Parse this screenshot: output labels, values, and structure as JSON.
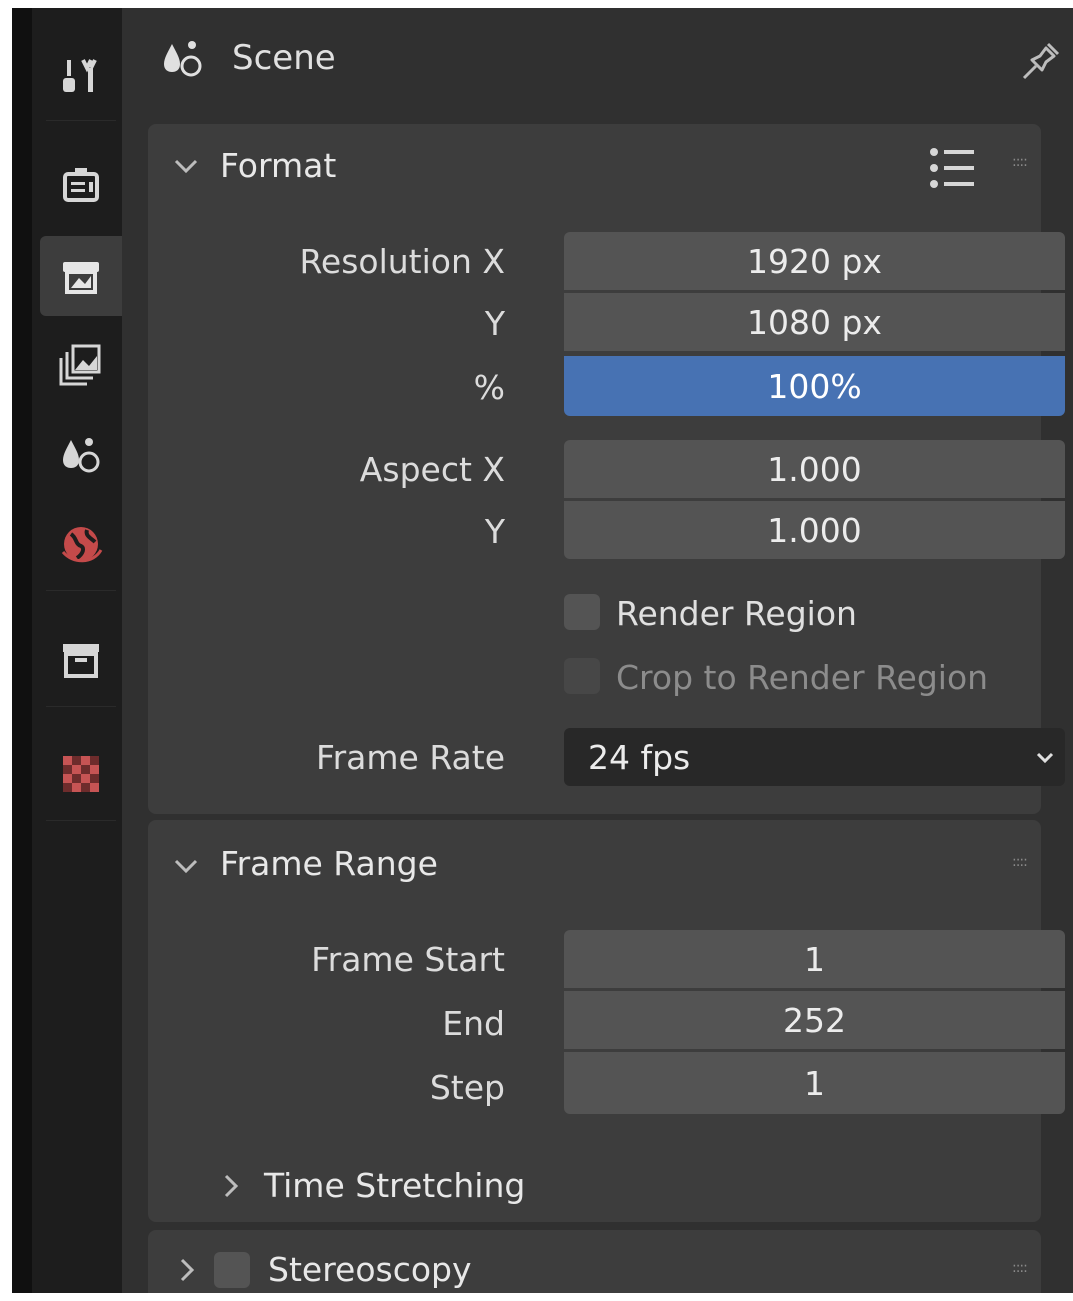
{
  "header": {
    "title": "Scene",
    "scene_icon": "scene-icon",
    "pin_icon": "pin-icon"
  },
  "sidebar": {
    "tabs": [
      {
        "name": "tool-tab",
        "icon": "tool-icon",
        "active": false
      },
      {
        "name": "render-tab",
        "icon": "render-icon",
        "active": false
      },
      {
        "name": "output-tab",
        "icon": "output-printer-icon",
        "active": true
      },
      {
        "name": "view-layer-tab",
        "icon": "view-layer-icon",
        "active": false
      },
      {
        "name": "scene-tab",
        "icon": "scene-icon",
        "active": false
      },
      {
        "name": "world-tab",
        "icon": "world-icon",
        "active": false
      },
      {
        "name": "collection-tab",
        "icon": "collection-box-icon",
        "active": false
      },
      {
        "name": "texture-tab",
        "icon": "texture-checker-icon",
        "active": false
      }
    ]
  },
  "format": {
    "title": "Format",
    "resolution_x_label": "Resolution X",
    "resolution_x": "1920 px",
    "resolution_y_label": "Y",
    "resolution_y": "1080 px",
    "percent_label": "%",
    "percent": "100%",
    "aspect_x_label": "Aspect X",
    "aspect_x": "1.000",
    "aspect_y_label": "Y",
    "aspect_y": "1.000",
    "render_region_label": "Render Region",
    "render_region_checked": false,
    "crop_label": "Crop to Render Region",
    "crop_checked": false,
    "frame_rate_label": "Frame Rate",
    "frame_rate": "24 fps"
  },
  "frame_range": {
    "title": "Frame Range",
    "start_label": "Frame Start",
    "start": "1",
    "end_label": "End",
    "end": "252",
    "step_label": "Step",
    "step": "1",
    "time_stretching_label": "Time Stretching"
  },
  "stereoscopy": {
    "title": "Stereoscopy",
    "enabled": false
  },
  "colors": {
    "panel_bg": "#3d3d3d",
    "field_bg": "#545454",
    "accent_blue": "#4772b3",
    "editor_bg": "#303030"
  }
}
